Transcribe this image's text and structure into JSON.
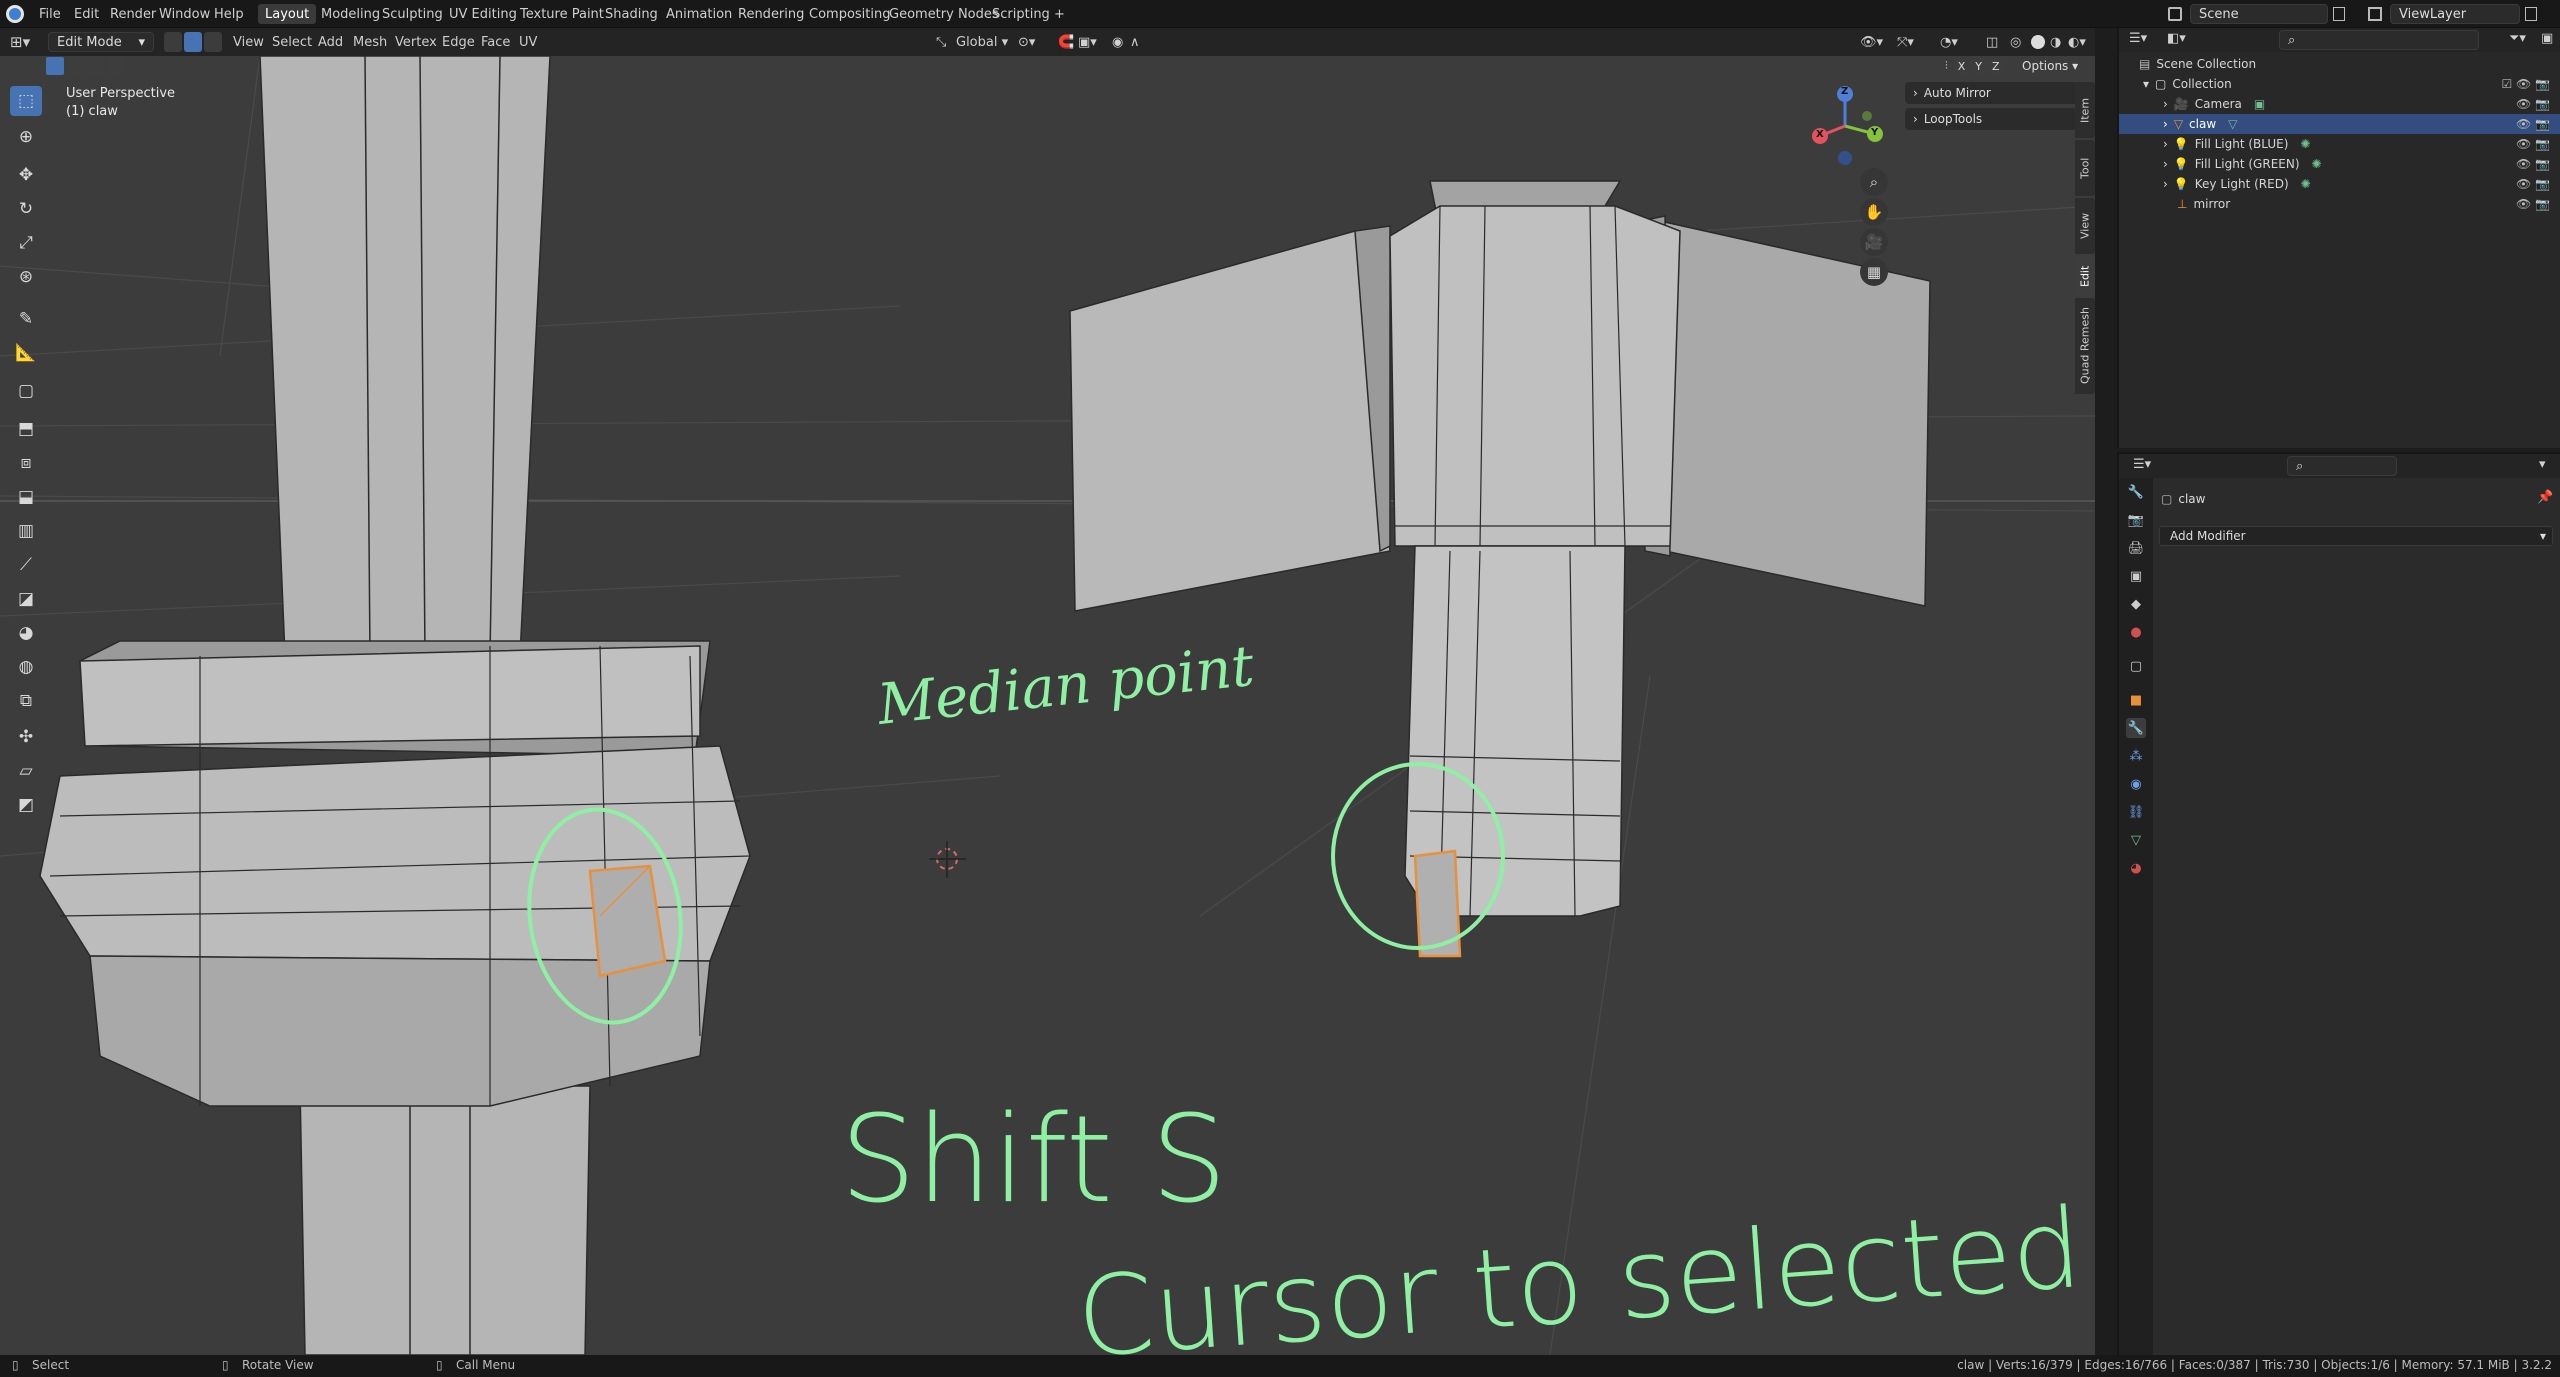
{
  "menu": [
    "File",
    "Edit",
    "Render",
    "Window",
    "Help"
  ],
  "workspaces": [
    "Layout",
    "Modeling",
    "Sculpting",
    "UV Editing",
    "Texture Paint",
    "Shading",
    "Animation",
    "Rendering",
    "Compositing",
    "Geometry Nodes",
    "Scripting"
  ],
  "workspace_add": "+",
  "scene": "Scene",
  "view_layer": "ViewLayer",
  "viewport_header": {
    "mode": "Edit Mode",
    "menus": [
      "View",
      "Select",
      "Add",
      "Mesh",
      "Vertex",
      "Edge",
      "Face",
      "UV"
    ],
    "orientation": "Global",
    "axis_x": "X",
    "axis_y": "Y",
    "axis_z": "Z",
    "options": "Options"
  },
  "viewport": {
    "perspective": "User Perspective",
    "object": "(1) claw",
    "panels": [
      "Auto Mirror",
      "LoopTools"
    ],
    "side_tabs": [
      "Item",
      "Tool",
      "View",
      "Edit",
      "Quad Remesh"
    ],
    "gizmo": {
      "x": "X",
      "y": "Y",
      "z": "Z"
    },
    "annotations": [
      "Median point",
      "Shift S",
      "Cursor to selected"
    ]
  },
  "outliner": {
    "root": "Scene Collection",
    "collection": "Collection",
    "items": [
      "Camera",
      "claw",
      "Fill Light (BLUE)",
      "Fill Light (GREEN)",
      "Key Light (RED)",
      "mirror"
    ],
    "selected": "claw"
  },
  "properties": {
    "object_name": "claw",
    "add_modifier": "Add Modifier"
  },
  "statusbar": {
    "select": "Select",
    "rotate": "Rotate View",
    "call_menu": "Call Menu",
    "stats": "claw | Verts:16/379 | Edges:16/766 | Faces:0/387 | Tris:730 | Objects:1/6 | Memory: 57.1 MiB | 3.2.2"
  },
  "colors": {
    "accent": "#4772b3",
    "selection": "#e8903a",
    "annotation": "#8ff0a3",
    "viewport_bg": "#3c3c3c"
  }
}
